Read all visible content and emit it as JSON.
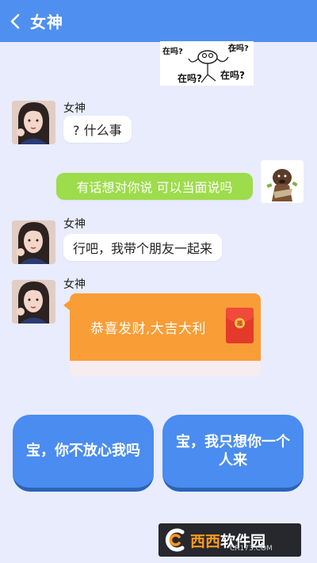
{
  "header": {
    "back_label": "<",
    "title": "女神"
  },
  "sticker_top": {
    "words": [
      "在吗?",
      "在吗?",
      "在吗?",
      "在吗?"
    ]
  },
  "messages": [
    {
      "sender": "女神",
      "text": "? 什么事",
      "side": "left"
    },
    {
      "sender": "me",
      "text": "有话想对你说 可以当面说吗",
      "side": "right"
    },
    {
      "sender": "女神",
      "text": "行吧，我带个朋友一起来",
      "side": "left"
    },
    {
      "sender": "女神",
      "text": "恭喜发财,大吉大利",
      "side": "left",
      "type": "red-packet"
    }
  ],
  "red_packet": {
    "coin_char": "福"
  },
  "choices": [
    {
      "label": "宝，你不放心我吗"
    },
    {
      "label": "宝，我只想你一个人来"
    }
  ],
  "watermark": {
    "main_hi": "西西",
    "main": "软件园",
    "sub": "CR173.COM"
  },
  "colors": {
    "header_bg": "#4f8ff0",
    "page_bg": "#e9ecfd",
    "my_bubble": "#9ddc4b",
    "red_packet": "#f99d36",
    "choice_button": "#4a8cf0"
  }
}
